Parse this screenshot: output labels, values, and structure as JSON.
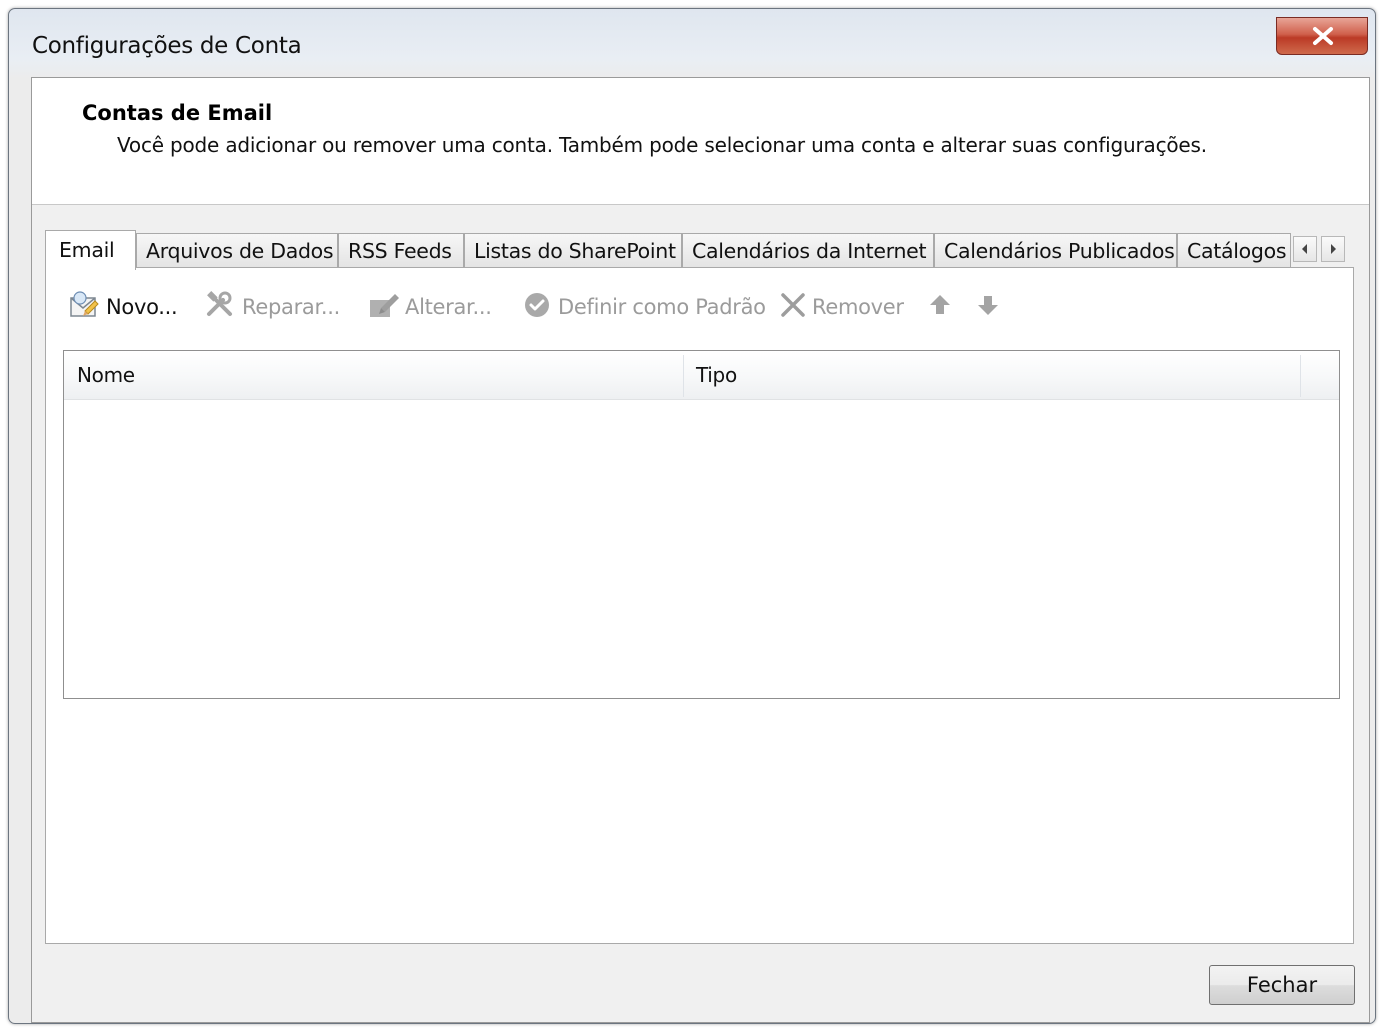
{
  "window": {
    "title": "Configurações de Conta"
  },
  "header": {
    "title": "Contas de Email",
    "description": "Você pode adicionar ou remover uma conta. Também pode selecionar uma conta e alterar suas configurações."
  },
  "tabs": [
    {
      "label": "Email",
      "active": true
    },
    {
      "label": "Arquivos de Dados"
    },
    {
      "label": "RSS Feeds"
    },
    {
      "label": "Listas do SharePoint"
    },
    {
      "label": "Calendários da Internet"
    },
    {
      "label": "Calendários Publicados"
    },
    {
      "label": "Catálogos"
    }
  ],
  "toolbar": {
    "new": "Novo...",
    "repair": "Reparar...",
    "change": "Alterar...",
    "set_default": "Definir como Padrão",
    "remove": "Remover"
  },
  "list": {
    "columns": [
      "Nome",
      "Tipo"
    ],
    "rows": []
  },
  "footer": {
    "close_label": "Fechar"
  },
  "colors": {
    "close_button": "#c9503b",
    "disabled_text": "#9b9b9b"
  }
}
